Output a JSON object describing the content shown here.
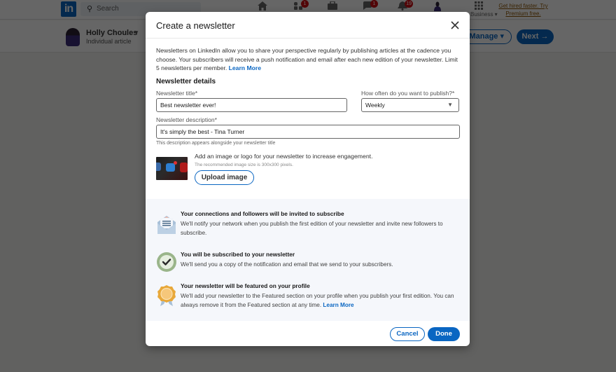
{
  "topnav": {
    "logo_text": "in",
    "search_placeholder": "Search",
    "icons": [
      {
        "name": "home-icon",
        "glyph": "⌂",
        "badge": null
      },
      {
        "name": "my-network-icon",
        "glyph": "▪",
        "badge": "1"
      },
      {
        "name": "jobs-icon",
        "glyph": "▬",
        "badge": null
      },
      {
        "name": "messaging-icon",
        "glyph": "●",
        "badge": "1"
      },
      {
        "name": "notifications-icon",
        "glyph": "▲",
        "badge": "19"
      }
    ],
    "for_business_label": "Business ▾",
    "premium_link": "Get hired faster. Try Premium free."
  },
  "subbar": {
    "author_name": "Holly Choules",
    "author_caret": "▼",
    "article_type": "Individual article",
    "manage_label": "Manage ▾",
    "next_label": "Next →"
  },
  "modal": {
    "title": "Create a newsletter",
    "intro_text": "Newsletters on LinkedIn allow you to share your perspective regularly by publishing articles at the cadence you choose. Your subscribers will receive a push notification and email after each new edition of your newsletter. Limit 5 newsletters per member.",
    "intro_link": "Learn More",
    "details_heading": "Newsletter details",
    "title_label": "Newsletter title*",
    "title_value": "Best newsletter ever!",
    "frequency_label": "How often do you want to publish?*",
    "frequency_value": "Weekly",
    "description_label": "Newsletter description*",
    "description_value": "It's simply the best - Tina Turner",
    "description_helper": "This description appears alongside your newsletter title",
    "image_prompt": "Add an image or logo for your newsletter to increase engagement.",
    "image_hint": "The recommended image size is 300x300 pixels.",
    "upload_label": "Upload image",
    "info": [
      {
        "icon": "envelope-icon",
        "title": "Your connections and followers will be invited to subscribe",
        "desc": "We'll notify your network when you publish the first edition of your newsletter and invite new followers to subscribe."
      },
      {
        "icon": "checkmark-circle-icon",
        "title": "You will be subscribed to your newsletter",
        "desc": "We'll send you a copy of the notification and email that we send to your subscribers."
      },
      {
        "icon": "award-badge-icon",
        "title": "Your newsletter will be featured on your profile",
        "desc": "We'll add your newsletter to the Featured section on your profile when you publish your first edition. You can always remove it from the Featured section at any time.",
        "link": "Learn More"
      }
    ],
    "cancel_label": "Cancel",
    "done_label": "Done"
  },
  "colors": {
    "brand_blue": "#0a66c2",
    "badge_red": "#cc1016",
    "premium_gold": "#915907"
  }
}
